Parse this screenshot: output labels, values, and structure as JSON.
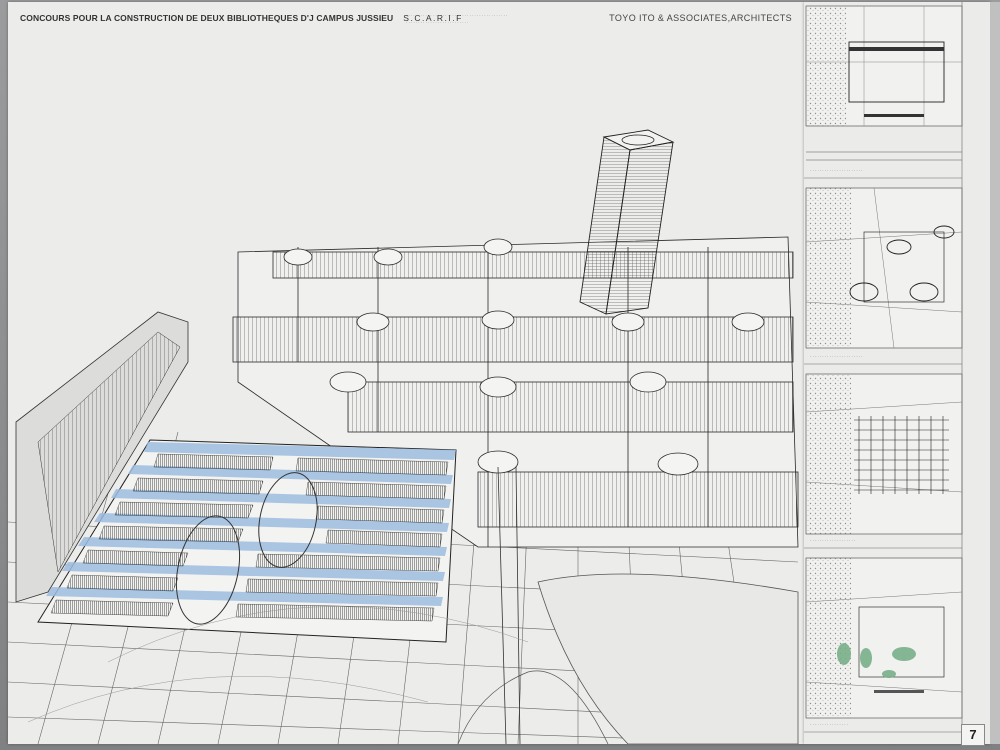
{
  "poster": {
    "title": "CONCOURS POUR LA CONSTRUCTION DE DEUX BIBLIOTHEQUES  D'J CAMPUS  JUSSIEU",
    "acronym": "S.C.A.R.I.F",
    "architect": "TOYO ITO & ASSOCIATES,ARCHITECTS",
    "page_number": "7"
  },
  "colors": {
    "paper": "#ececea",
    "line": "#2a2a2a",
    "accent_blue": "#8fb3dc",
    "accent_green": "#79b08a"
  },
  "panels": [
    {
      "id": "site-plan-1"
    },
    {
      "id": "site-plan-2"
    },
    {
      "id": "site-plan-3"
    },
    {
      "id": "site-plan-4"
    }
  ]
}
